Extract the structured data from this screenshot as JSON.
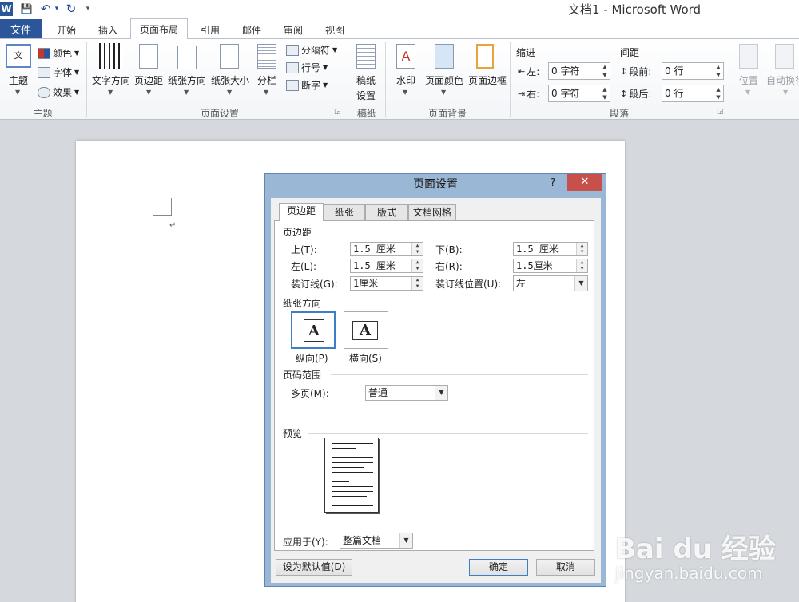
{
  "window": {
    "title": "文档1  -  Microsoft Word"
  },
  "quick_access": {
    "app_icon": "W",
    "save_icon": "💾",
    "undo_icon": "↶",
    "redo_icon": "↻",
    "more_icon": "▾"
  },
  "tabs": [
    {
      "label": "文件"
    },
    {
      "label": "开始"
    },
    {
      "label": "插入"
    },
    {
      "label": "页面布局"
    },
    {
      "label": "引用"
    },
    {
      "label": "邮件"
    },
    {
      "label": "审阅"
    },
    {
      "label": "视图"
    }
  ],
  "ribbon": {
    "theme_group": {
      "label": "主题",
      "theme_btn": "主题",
      "colors": "颜色",
      "fonts": "字体",
      "effects": "效果"
    },
    "page_setup_group": {
      "label": "页面设置",
      "text_direction": "文字方向",
      "margins": "页边距",
      "orientation": "纸张方向",
      "size": "纸张大小",
      "columns": "分栏",
      "breaks": "分隔符",
      "line_numbers": "行号",
      "hyphenation": "断字"
    },
    "manuscript_group": {
      "label": "稿纸",
      "button_line1": "稿纸",
      "button_line2": "设置"
    },
    "background_group": {
      "label": "页面背景",
      "watermark": "水印",
      "page_color": "页面颜色",
      "page_borders": "页面边框"
    },
    "paragraph_group": {
      "label": "段落",
      "indent_title": "缩进",
      "indent_left_label": "左:",
      "indent_left_value": "0 字符",
      "indent_right_label": "右:",
      "indent_right_value": "0 字符",
      "spacing_title": "间距",
      "before_label": "段前:",
      "before_value": "0 行",
      "after_label": "段后:",
      "after_value": "0 行"
    },
    "arrange_group": {
      "position": "位置",
      "wrap": "自动换行"
    }
  },
  "document": {
    "paragraph_mark": "↵"
  },
  "dialog": {
    "title": "页面设置",
    "help": "?",
    "close": "✕",
    "tabs": [
      "页边距",
      "纸张",
      "版式",
      "文档网格"
    ],
    "margins_section": "页边距",
    "top_label": "上(T):",
    "top_value": "1.5 厘米",
    "bottom_label": "下(B):",
    "bottom_value": "1.5 厘米",
    "left_label": "左(L):",
    "left_value": "1.5 厘米",
    "right_label": "右(R):",
    "right_value": "1.5厘米",
    "gutter_label": "装订线(G):",
    "gutter_value": "1厘米",
    "gutter_pos_label": "装订线位置(U):",
    "gutter_pos_value": "左",
    "orientation_section": "纸张方向",
    "portrait_icon_text": "A",
    "portrait_label": "纵向(P)",
    "landscape_icon_text": "A",
    "landscape_label": "横向(S)",
    "pages_section": "页码范围",
    "multiple_pages_label": "多页(M):",
    "multiple_pages_value": "普通",
    "preview_section": "预览",
    "apply_label": "应用于(Y):",
    "apply_value": "整篇文档",
    "default_button": "设为默认值(D)",
    "ok_button": "确定",
    "cancel_button": "取消"
  },
  "watermark": {
    "brand": "Bai du 经验",
    "url": "jingyan.baidu.com"
  }
}
